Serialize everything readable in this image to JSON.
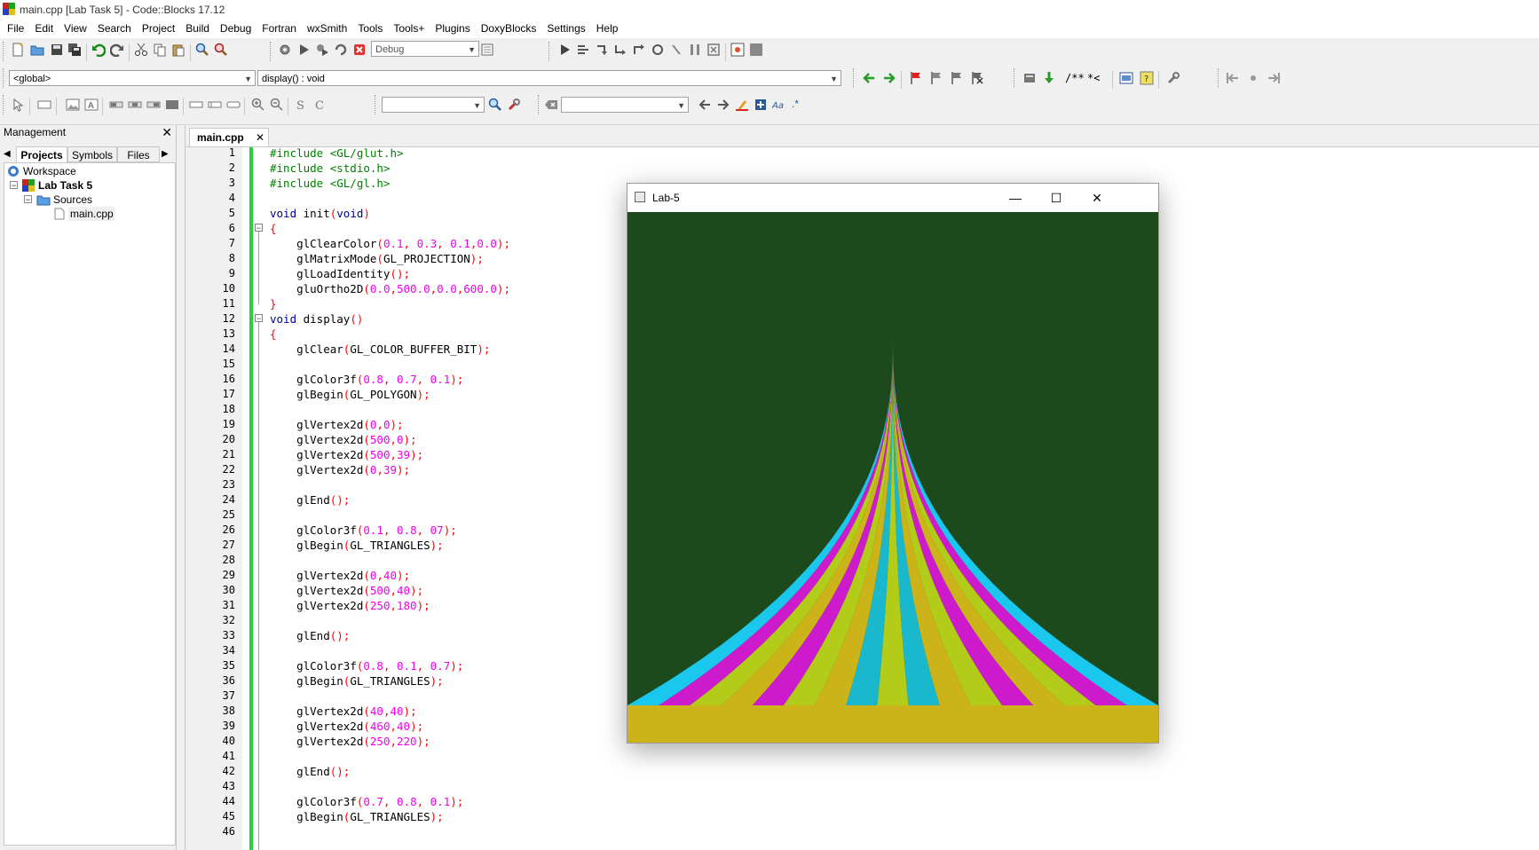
{
  "window": {
    "title": "main.cpp [Lab Task 5] - Code::Blocks 17.12"
  },
  "menu": [
    "File",
    "Edit",
    "View",
    "Search",
    "Project",
    "Build",
    "Debug",
    "Fortran",
    "wxSmith",
    "Tools",
    "Tools+",
    "Plugins",
    "DoxyBlocks",
    "Settings",
    "Help"
  ],
  "toolbar": {
    "build_target": "Debug",
    "scope": "<global>",
    "function": "display() : void",
    "doxy_block": "/**",
    "doxy_line": "*<",
    "search_value": "",
    "regex_value": "",
    "regex_label": ".*"
  },
  "management": {
    "title": "Management",
    "tabs": [
      "Projects",
      "Symbols",
      "Files"
    ],
    "tree": {
      "workspace": "Workspace",
      "project": "Lab Task 5",
      "folder": "Sources",
      "file": "main.cpp"
    }
  },
  "editor": {
    "tab": "main.cpp",
    "lines": [
      [
        [
          "pp",
          "#include <GL/glut.h>"
        ]
      ],
      [
        [
          "pp",
          "#include <stdio.h>"
        ]
      ],
      [
        [
          "pp",
          "#include <GL/gl.h>"
        ]
      ],
      [],
      [
        [
          "kw",
          "void"
        ],
        [
          "t",
          " init"
        ],
        [
          "op",
          "("
        ],
        [
          "kw",
          "void"
        ],
        [
          "op",
          ")"
        ]
      ],
      [
        [
          "op",
          "{"
        ]
      ],
      [
        [
          "t",
          "    glClearColor"
        ],
        [
          "op",
          "("
        ],
        [
          "num",
          "0.1"
        ],
        [
          "op",
          ", "
        ],
        [
          "num",
          "0.3"
        ],
        [
          "op",
          ", "
        ],
        [
          "num",
          "0.1"
        ],
        [
          "op",
          ","
        ],
        [
          "num",
          "0.0"
        ],
        [
          "op",
          ");"
        ]
      ],
      [
        [
          "t",
          "    glMatrixMode"
        ],
        [
          "op",
          "("
        ],
        [
          "t",
          "GL_PROJECTION"
        ],
        [
          "op",
          ");"
        ]
      ],
      [
        [
          "t",
          "    glLoadIdentity"
        ],
        [
          "op",
          "();"
        ]
      ],
      [
        [
          "t",
          "    gluOrtho2D"
        ],
        [
          "op",
          "("
        ],
        [
          "num",
          "0.0"
        ],
        [
          "op",
          ","
        ],
        [
          "num",
          "500.0"
        ],
        [
          "op",
          ","
        ],
        [
          "num",
          "0.0"
        ],
        [
          "op",
          ","
        ],
        [
          "num",
          "600.0"
        ],
        [
          "op",
          ");"
        ]
      ],
      [
        [
          "op",
          "}"
        ]
      ],
      [
        [
          "kw",
          "void"
        ],
        [
          "t",
          " display"
        ],
        [
          "op",
          "()"
        ]
      ],
      [
        [
          "op",
          "{"
        ]
      ],
      [
        [
          "t",
          "    glClear"
        ],
        [
          "op",
          "("
        ],
        [
          "t",
          "GL_COLOR_BUFFER_BIT"
        ],
        [
          "op",
          ");"
        ]
      ],
      [],
      [
        [
          "t",
          "    glColor3f"
        ],
        [
          "op",
          "("
        ],
        [
          "num",
          "0.8"
        ],
        [
          "op",
          ", "
        ],
        [
          "num",
          "0.7"
        ],
        [
          "op",
          ", "
        ],
        [
          "num",
          "0.1"
        ],
        [
          "op",
          ");"
        ]
      ],
      [
        [
          "t",
          "    glBegin"
        ],
        [
          "op",
          "("
        ],
        [
          "t",
          "GL_POLYGON"
        ],
        [
          "op",
          ");"
        ]
      ],
      [],
      [
        [
          "t",
          "    glVertex2d"
        ],
        [
          "op",
          "("
        ],
        [
          "num",
          "0"
        ],
        [
          "op",
          ","
        ],
        [
          "num",
          "0"
        ],
        [
          "op",
          ");"
        ]
      ],
      [
        [
          "t",
          "    glVertex2d"
        ],
        [
          "op",
          "("
        ],
        [
          "num",
          "500"
        ],
        [
          "op",
          ","
        ],
        [
          "num",
          "0"
        ],
        [
          "op",
          ");"
        ]
      ],
      [
        [
          "t",
          "    glVertex2d"
        ],
        [
          "op",
          "("
        ],
        [
          "num",
          "500"
        ],
        [
          "op",
          ","
        ],
        [
          "num",
          "39"
        ],
        [
          "op",
          ");"
        ]
      ],
      [
        [
          "t",
          "    glVertex2d"
        ],
        [
          "op",
          "("
        ],
        [
          "num",
          "0"
        ],
        [
          "op",
          ","
        ],
        [
          "num",
          "39"
        ],
        [
          "op",
          ");"
        ]
      ],
      [],
      [
        [
          "t",
          "    glEnd"
        ],
        [
          "op",
          "();"
        ]
      ],
      [],
      [
        [
          "t",
          "    glColor3f"
        ],
        [
          "op",
          "("
        ],
        [
          "num",
          "0.1"
        ],
        [
          "op",
          ", "
        ],
        [
          "num",
          "0.8"
        ],
        [
          "op",
          ", "
        ],
        [
          "num",
          "07"
        ],
        [
          "op",
          ");"
        ]
      ],
      [
        [
          "t",
          "    glBegin"
        ],
        [
          "op",
          "("
        ],
        [
          "t",
          "GL_TRIANGLES"
        ],
        [
          "op",
          ");"
        ]
      ],
      [],
      [
        [
          "t",
          "    glVertex2d"
        ],
        [
          "op",
          "("
        ],
        [
          "num",
          "0"
        ],
        [
          "op",
          ","
        ],
        [
          "num",
          "40"
        ],
        [
          "op",
          ");"
        ]
      ],
      [
        [
          "t",
          "    glVertex2d"
        ],
        [
          "op",
          "("
        ],
        [
          "num",
          "500"
        ],
        [
          "op",
          ","
        ],
        [
          "num",
          "40"
        ],
        [
          "op",
          ");"
        ]
      ],
      [
        [
          "t",
          "    glVertex2d"
        ],
        [
          "op",
          "("
        ],
        [
          "num",
          "250"
        ],
        [
          "op",
          ","
        ],
        [
          "num",
          "180"
        ],
        [
          "op",
          ");"
        ]
      ],
      [],
      [
        [
          "t",
          "    glEnd"
        ],
        [
          "op",
          "();"
        ]
      ],
      [],
      [
        [
          "t",
          "    glColor3f"
        ],
        [
          "op",
          "("
        ],
        [
          "num",
          "0.8"
        ],
        [
          "op",
          ", "
        ],
        [
          "num",
          "0.1"
        ],
        [
          "op",
          ", "
        ],
        [
          "num",
          "0.7"
        ],
        [
          "op",
          ");"
        ]
      ],
      [
        [
          "t",
          "    glBegin"
        ],
        [
          "op",
          "("
        ],
        [
          "t",
          "GL_TRIANGLES"
        ],
        [
          "op",
          ");"
        ]
      ],
      [],
      [
        [
          "t",
          "    glVertex2d"
        ],
        [
          "op",
          "("
        ],
        [
          "num",
          "40"
        ],
        [
          "op",
          ","
        ],
        [
          "num",
          "40"
        ],
        [
          "op",
          ");"
        ]
      ],
      [
        [
          "t",
          "    glVertex2d"
        ],
        [
          "op",
          "("
        ],
        [
          "num",
          "460"
        ],
        [
          "op",
          ","
        ],
        [
          "num",
          "40"
        ],
        [
          "op",
          ");"
        ]
      ],
      [
        [
          "t",
          "    glVertex2d"
        ],
        [
          "op",
          "("
        ],
        [
          "num",
          "250"
        ],
        [
          "op",
          ","
        ],
        [
          "num",
          "220"
        ],
        [
          "op",
          ");"
        ]
      ],
      [],
      [
        [
          "t",
          "    glEnd"
        ],
        [
          "op",
          "();"
        ]
      ],
      [],
      [
        [
          "t",
          "    glColor3f"
        ],
        [
          "op",
          "("
        ],
        [
          "num",
          "0.7"
        ],
        [
          "op",
          ", "
        ],
        [
          "num",
          "0.8"
        ],
        [
          "op",
          ", "
        ],
        [
          "num",
          "0.1"
        ],
        [
          "op",
          ");"
        ]
      ],
      [
        [
          "t",
          "    glBegin"
        ],
        [
          "op",
          "("
        ],
        [
          "t",
          "GL_TRIANGLES"
        ],
        [
          "op",
          ");"
        ]
      ],
      []
    ]
  },
  "lab_window": {
    "title": "Lab-5",
    "colors": {
      "background": "#1c4a1c",
      "base": "#ccb31a",
      "cyan": "#1ab8cc",
      "magenta": "#cc1acc",
      "lime": "#b3cc1a",
      "sky": "#1ac8ee"
    }
  }
}
